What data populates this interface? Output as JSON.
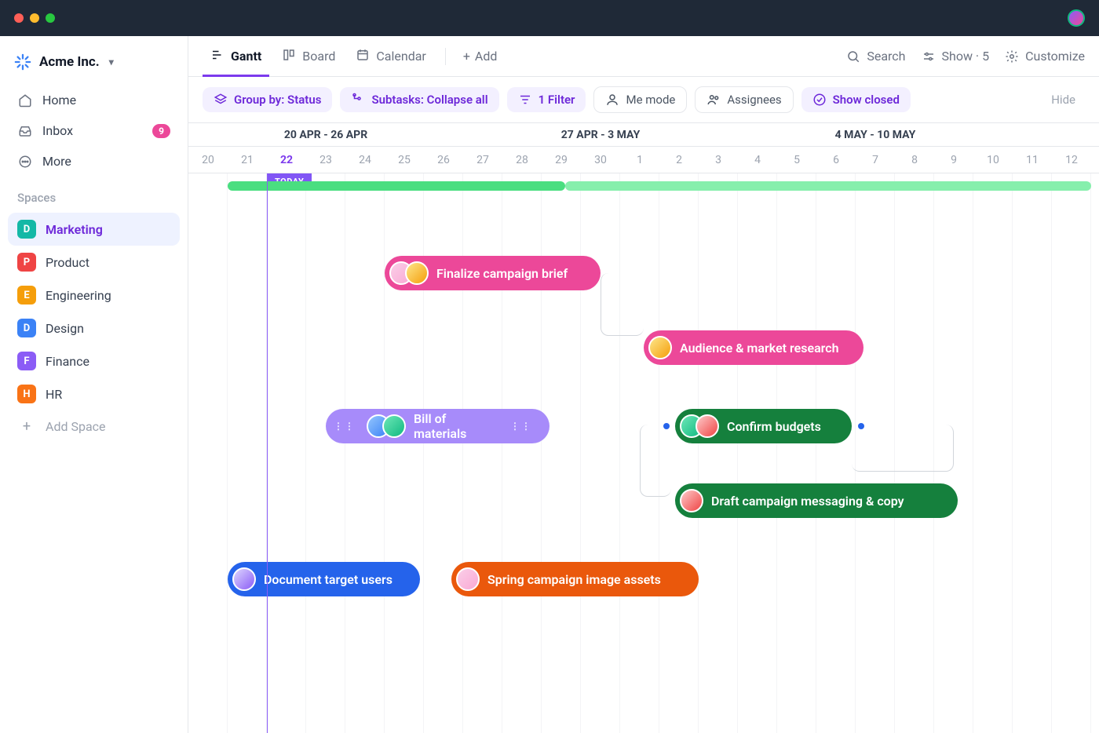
{
  "workspace": {
    "name": "Acme Inc."
  },
  "nav": {
    "home": "Home",
    "inbox": "Inbox",
    "inbox_count": "9",
    "more": "More"
  },
  "spaces_label": "Spaces",
  "spaces": [
    {
      "letter": "D",
      "label": "Marketing",
      "color": "#14b8a6",
      "active": true
    },
    {
      "letter": "P",
      "label": "Product",
      "color": "#ef4444",
      "active": false
    },
    {
      "letter": "E",
      "label": "Engineering",
      "color": "#f59e0b",
      "active": false
    },
    {
      "letter": "D",
      "label": "Design",
      "color": "#3b82f6",
      "active": false
    },
    {
      "letter": "F",
      "label": "Finance",
      "color": "#8b5cf6",
      "active": false
    },
    {
      "letter": "H",
      "label": "HR",
      "color": "#f97316",
      "active": false
    }
  ],
  "add_space": "Add Space",
  "views": {
    "tabs": [
      {
        "label": "Gantt",
        "active": true
      },
      {
        "label": "Board",
        "active": false
      },
      {
        "label": "Calendar",
        "active": false
      }
    ],
    "add": "Add",
    "right": {
      "search": "Search",
      "show": "Show · 5",
      "customize": "Customize"
    }
  },
  "filters": {
    "group_by": "Group by: Status",
    "subtasks": "Subtasks: Collapse all",
    "filter": "1 Filter",
    "me_mode": "Me mode",
    "assignees": "Assignees",
    "show_closed": "Show closed",
    "hide": "Hide"
  },
  "timeline": {
    "weeks": [
      "20 APR - 26 APR",
      "27 APR - 3 MAY",
      "4 MAY - 10 MAY"
    ],
    "days": [
      "20",
      "21",
      "22",
      "23",
      "24",
      "25",
      "26",
      "27",
      "28",
      "29",
      "30",
      "1",
      "2",
      "3",
      "4",
      "5",
      "6",
      "7",
      "8",
      "9",
      "10",
      "11",
      "12"
    ],
    "today": "TODAY",
    "today_index": 2
  },
  "tasks": [
    {
      "label": "Finalize campaign brief",
      "color": "pink",
      "start": 5,
      "span": 5.5,
      "row": 0,
      "avatars": 2,
      "handles": false
    },
    {
      "label": "Audience & market research",
      "color": "pink",
      "start": 11.6,
      "span": 5.6,
      "row": 1,
      "avatars": 1,
      "handles": false
    },
    {
      "label": "Bill of materials",
      "color": "purple",
      "start": 3.5,
      "span": 5.7,
      "row": 2,
      "avatars": 2,
      "handles": true
    },
    {
      "label": "Confirm budgets",
      "color": "green",
      "start": 12.4,
      "span": 4.5,
      "row": 2,
      "avatars": 2,
      "handles": false,
      "milestones": true
    },
    {
      "label": "Draft campaign messaging & copy",
      "color": "green",
      "start": 12.4,
      "span": 7.2,
      "row": 3,
      "avatars": 1,
      "handles": false
    },
    {
      "label": "Document target users",
      "color": "blue",
      "start": 1,
      "span": 4.9,
      "row": 4,
      "avatars": 1,
      "handles": false
    },
    {
      "label": "Spring campaign image assets",
      "color": "orange",
      "start": 6.7,
      "span": 6.3,
      "row": 4,
      "avatars": 1,
      "handles": false
    }
  ]
}
